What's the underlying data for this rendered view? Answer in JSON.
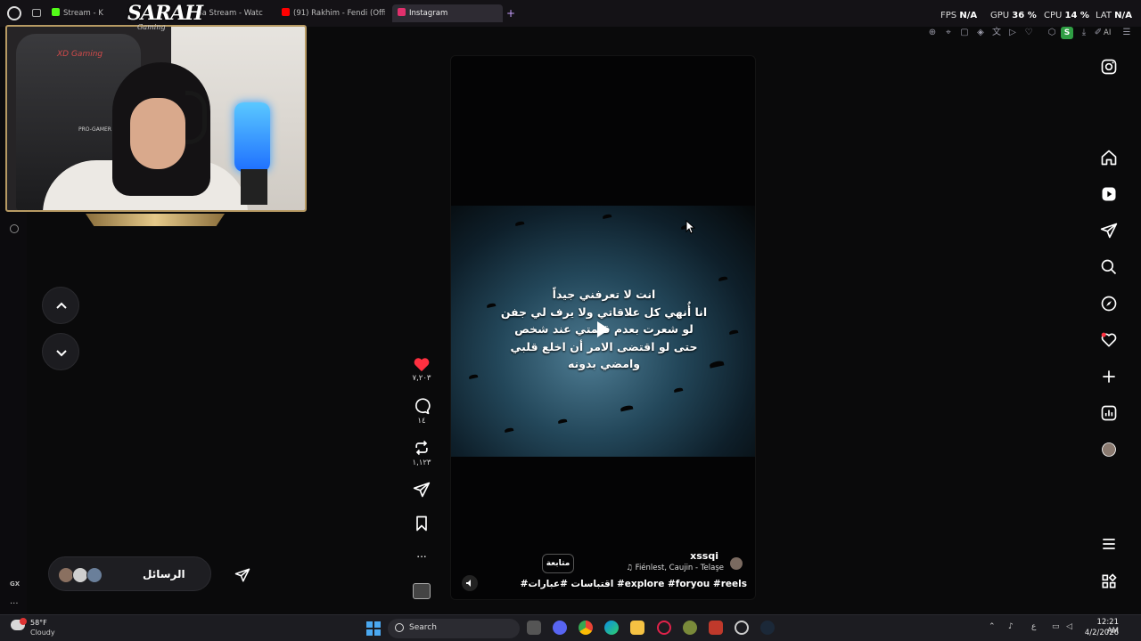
{
  "browser": {
    "tabs": [
      {
        "label": "Stream - K",
        "favicon_color": "#53fc18"
      },
      {
        "label": "Ga Stream - Watc",
        "favicon_color": "#9146ff"
      },
      {
        "label": "(91) Rakhim - Fendi (Offici",
        "favicon_color": "#ff0000"
      },
      {
        "label": "Instagram",
        "favicon_color": "#e1306c",
        "active": true
      }
    ],
    "new_tab": "+",
    "stats": {
      "fps_label": "FPS",
      "fps_value": "N/A",
      "gpu_label": "GPU",
      "gpu_value": "36 %",
      "cpu_label": "CPU",
      "cpu_value": "14 %",
      "lat_label": "LAT",
      "lat_value": "N/A"
    },
    "ext_badge": "S",
    "ai_label": "AI",
    "sidebar_gx": "GX",
    "sidebar_more": "..."
  },
  "overlay": {
    "logo": "SARAH",
    "logo_sub": "Gaming",
    "chair_brand": "XD Gaming",
    "chair_text": "PRO-GAMER"
  },
  "reel": {
    "text_lines": [
      "انت لا تعرفني جيداً",
      "انا أُنهي كل علاقاتي ولا يرف لي جفن",
      "لو شعرت بعدم قيمتي عند شخص",
      "حتى لو اقتضى الامر أن اخلع قلبي",
      "وامضي بدونه"
    ],
    "username": "xssqi",
    "audio": "Fiénlest, Caujin - Telaşe",
    "follow_label": "متابعة",
    "caption": "#اقتباسات #عبارات #explore #foryou #reels"
  },
  "actions": {
    "likes": "٧,٢٠٣",
    "comments": "١٤",
    "reposts": "١,١٢٣",
    "more": "..."
  },
  "messages": {
    "label": "الرسائل"
  },
  "taskbar": {
    "temperature": "58°F",
    "condition": "Cloudy",
    "search_label": "Search",
    "time": "12:21 AM",
    "date": "4/2/2026",
    "lang": "ع"
  },
  "colors": {
    "accent_gold": "#b79a63",
    "like_red": "#ff3040",
    "brand_purple": "#c9a0ff"
  }
}
